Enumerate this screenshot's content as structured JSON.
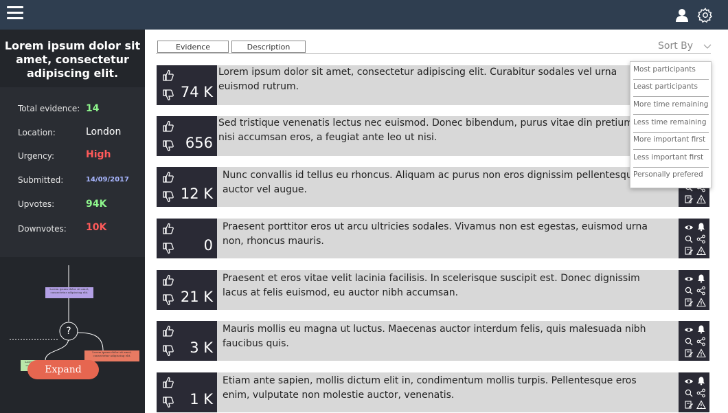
{
  "sidebar": {
    "title": "Lorem ipsum dolor sit amet, consectetur adipiscing elit.",
    "stats": {
      "total_evidence_label": "Total evidence:",
      "total_evidence_value": "14",
      "location_label": "Location:",
      "location_value": "London",
      "urgency_label": "Urgency:",
      "urgency_value": "High",
      "submitted_label": "Submitted:",
      "submitted_value": "14/09/2017",
      "upvotes_label": "Upvotes:",
      "upvotes_value": "94K",
      "downvotes_label": "Downvotes:",
      "downvotes_value": "10K"
    },
    "diagram": {
      "box_top": "Lorem ipsum dolor sit amet, consectetur adipiscing elit.",
      "box_left": "Lorem ipsum dolor sit amet, consectetur adipiscing elit.",
      "box_right": "Lorem ipsum dolor sit amet, consectetur adipiscing elit.",
      "question": "?"
    },
    "expand_label": "Expand"
  },
  "tabs": [
    "Evidence",
    "Description"
  ],
  "sort": {
    "label": "Sort By",
    "options": [
      "Most participants",
      "Least participants",
      "More time remaining",
      "Less time remaining",
      "More important first",
      "Less important first",
      "Personally prefered"
    ]
  },
  "evidence": [
    {
      "count": "74 K",
      "text": "Lorem ipsum dolor sit amet, consectetur adipiscing elit. Curabitur sodales vel urna euismod rutrum."
    },
    {
      "count": "656",
      "text": "Sed tristique venenatis lectus nec euismod. Donec bibendum, purus vitae din pretium, elit nisi accumsan eros, a feugiat ante leo ut nisi."
    },
    {
      "count": "12 K",
      "text": "Nunc convallis id tellus eu rhoncus. Aliquam ac purus non eros dignissim pellentesque auctor vel augue."
    },
    {
      "count": "0",
      "text": "Praesent porttitor eros ut arcu ultricies sodales. Vivamus non est egestas, euismod urna non, rhoncus mauris."
    },
    {
      "count": "21 K",
      "text": "Praesent et eros vitae velit lacinia facilisis. In scelerisque suscipit est. Donec dignissim lacus at felis euismod, eu auctor nibh accumsan."
    },
    {
      "count": "3 K",
      "text": "Mauris mollis eu magna ut luctus. Maecenas auctor interdum felis, quis malesuada nibh faucibus quis."
    },
    {
      "count": "1 K",
      "text": "Etiam ante sapien, mollis dictum elit in, condimentum mollis turpis. Pellentesque eros enim, vulputate non molestie auctor, venenatis."
    }
  ],
  "colors": {
    "topbar": "#2f3e50",
    "sidebar": "#2a2d33",
    "green_value": "#8ef58c",
    "red_value": "#ff5a5a",
    "blue_value": "#a8b6ff",
    "expand_button": "#e66650"
  }
}
